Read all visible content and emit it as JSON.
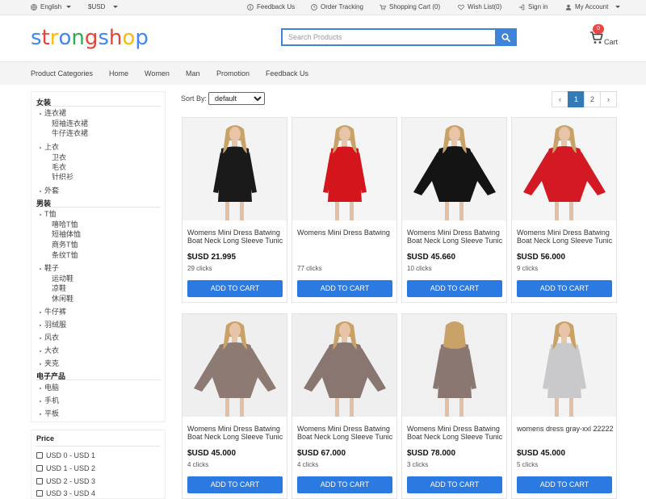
{
  "topbar": {
    "language": "English",
    "currency": "$USD",
    "feedback": "Feedback Us",
    "order_tracking": "Order Tracking",
    "shopping_cart": "Shopping Cart (0)",
    "wish_list": "Wish List(0)",
    "sign_in": "Sign in",
    "my_account": "My Account"
  },
  "header": {
    "logo_letters": [
      "s",
      "t",
      "r",
      "o",
      "n",
      "g",
      "s",
      "h",
      "o",
      "p"
    ],
    "logo_colors": [
      "#4285f4",
      "#ea4335",
      "#fbbc05",
      "#4285f4",
      "#34a853",
      "#ea4335",
      "#4285f4",
      "#ea4335",
      "#fbbc05",
      "#4285f4"
    ],
    "search_placeholder": "Search Products",
    "cart_count": "0",
    "cart_label": "Cart"
  },
  "nav": {
    "items": [
      "Product Categories",
      "Home",
      "Women",
      "Man",
      "Promotion",
      "Feedback Us"
    ]
  },
  "sidebar": {
    "women": "女装",
    "dresses": "连衣裙",
    "short_sleeve_dress": "短袖连衣裙",
    "denim_dress": "牛仔连衣裙",
    "tops": "上衣",
    "sweatshirt": "卫衣",
    "sweater": "毛衣",
    "knitwear": "针织衫",
    "outerwear": "外套",
    "men": "男装",
    "tshirt": "T恤",
    "hiphop_tshirt": "嘻哈T恤",
    "short_sleeve_tee": "短袖体恤",
    "business_tshirt": "商务T恤",
    "striped_tshirt": "条纹T恤",
    "shoes": "鞋子",
    "sneakers": "运动鞋",
    "sandals": "凉鞋",
    "casual_shoes": "休闲鞋",
    "jeans": "牛仔裤",
    "down_jacket": "羽绒服",
    "windbreaker": "风衣",
    "coat": "大衣",
    "jacket": "夹克",
    "electronics": "电子产品",
    "computer": "电脑",
    "phone": "手机",
    "tablet": "平板"
  },
  "price_filter": {
    "title": "Price",
    "options": [
      "USD 0 - USD 1",
      "USD 1 - USD 2",
      "USD 2 - USD 3",
      "USD 3 - USD 4"
    ]
  },
  "toolbar": {
    "sort_label": "Sort By:",
    "sort_value": "default",
    "pages": [
      "‹",
      "1",
      "2",
      "›"
    ],
    "active_page": "1"
  },
  "products": [
    {
      "name": "Womens Mini Dress Batwing Boat Neck Long Sleeve Tunic",
      "price": "$USD 21.995",
      "clicks": "29 clicks",
      "button": "ADD TO CART",
      "dress_color": "#1a1a1a",
      "bg": "#f3f3f3"
    },
    {
      "name": "Womens Mini Dress Batwing",
      "price": "",
      "clicks": "77 clicks",
      "button": "ADD TO CART",
      "dress_color": "#d4161c",
      "bg": "#f5f5f5"
    },
    {
      "name": "Womens Mini Dress Batwing Boat Neck Long Sleeve Tunic",
      "price": "$USD 45.660",
      "clicks": "10 clicks",
      "button": "ADD TO CART",
      "dress_color": "#141414",
      "bg": "#f3f3f3"
    },
    {
      "name": "Womens Mini Dress Batwing Boat Neck Long Sleeve Tunic",
      "price": "$USD 56.000",
      "clicks": "9 clicks",
      "button": "ADD TO CART",
      "dress_color": "#d31a24",
      "bg": "#f5f5f5"
    },
    {
      "name": "Womens Mini Dress Batwing Boat Neck Long Sleeve Tunic",
      "price": "$USD 45.000",
      "clicks": "4 clicks",
      "button": "ADD TO CART",
      "dress_color": "#8d7a72",
      "bg": "#efefef"
    },
    {
      "name": "Womens Mini Dress Batwing Boat Neck Long Sleeve Tunic",
      "price": "$USD 67.000",
      "clicks": "4 clicks",
      "button": "ADD TO CART",
      "dress_color": "#8a7670",
      "bg": "#efefef"
    },
    {
      "name": "Womens Mini Dress Batwing Boat Neck Long Sleeve Tunic",
      "price": "$USD 78.000",
      "clicks": "3 clicks",
      "button": "ADD TO CART",
      "dress_color": "#8a7772",
      "bg": "#f0f0f0"
    },
    {
      "name": "womens dress gray-xxl 22222",
      "price": "$USD 45.000",
      "clicks": "5 clicks",
      "button": "ADD TO CART",
      "dress_color": "#c9c9cb",
      "bg": "#f3f3f3"
    }
  ],
  "colors": {
    "accent": "#3e84d8",
    "cart_button": "#2a7ae2",
    "pager_active": "#337ab7",
    "badge": "#e44444"
  }
}
